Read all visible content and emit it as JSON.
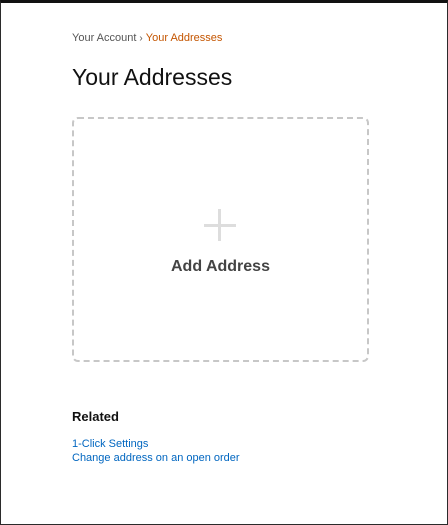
{
  "breadcrumb": {
    "parent": "Your Account",
    "separator": "›",
    "current": "Your Addresses"
  },
  "page": {
    "title": "Your Addresses"
  },
  "add_address_card": {
    "icon": "plus-icon",
    "label": "Add Address"
  },
  "related": {
    "title": "Related",
    "links": [
      {
        "label": "1-Click Settings"
      },
      {
        "label": "Change address on an open order"
      }
    ]
  },
  "colors": {
    "breadcrumb_current": "#c45500",
    "link": "#0066c0",
    "card_border": "#c7c7c7",
    "plus": "#dddddd"
  }
}
